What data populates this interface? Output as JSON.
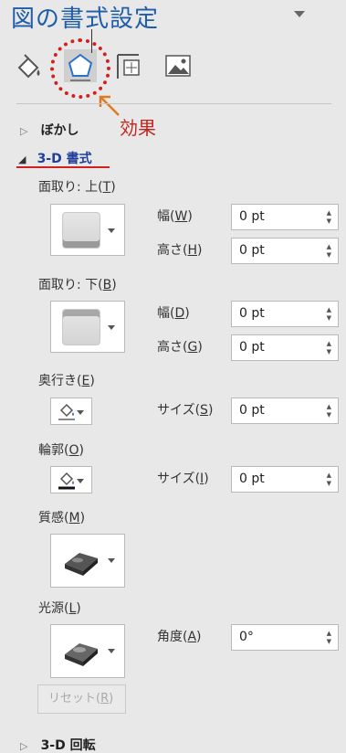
{
  "panel": {
    "title": "図の書式設定"
  },
  "annotation": {
    "label": "効果",
    "ring_color": "#d21f1f"
  },
  "tabs": [
    {
      "name": "fill-line",
      "icon": "paint-bucket-icon"
    },
    {
      "name": "effects",
      "icon": "pentagon-icon",
      "selected": true
    },
    {
      "name": "size-properties",
      "icon": "size-position-icon"
    },
    {
      "name": "picture",
      "icon": "picture-icon"
    }
  ],
  "sections": {
    "blur": {
      "title": "ぼかし",
      "expanded": false
    },
    "format3d": {
      "title": "3-D 書式",
      "expanded": true
    },
    "rotation3d": {
      "title": "3-D 回転",
      "expanded": false
    }
  },
  "bevel_top": {
    "label": "面取り: 上(",
    "key": "T",
    "width_label": "幅(",
    "width_key": "W",
    "width_value": "0 pt",
    "height_label": "高さ(",
    "height_key": "H",
    "height_value": "0 pt"
  },
  "bevel_bottom": {
    "label": "面取り: 下(",
    "key": "B",
    "width_label": "幅(",
    "width_key": "D",
    "width_value": "0 pt",
    "height_label": "高さ(",
    "height_key": "G",
    "height_value": "0 pt"
  },
  "depth": {
    "label": "奥行き(",
    "key": "E",
    "size_label": "サイズ(",
    "size_key": "S",
    "size_value": "0 pt"
  },
  "contour": {
    "label": "輪郭(",
    "key": "O",
    "size_label": "サイズ(",
    "size_key": "I",
    "size_value": "0 pt"
  },
  "material": {
    "label": "質感(",
    "key": "M"
  },
  "lighting": {
    "label": "光源(",
    "key": "L",
    "angle_label": "角度(",
    "angle_key": "A",
    "angle_value": "0°"
  },
  "reset": {
    "label": "リセット(",
    "key": "R"
  },
  "close_paren": ")"
}
